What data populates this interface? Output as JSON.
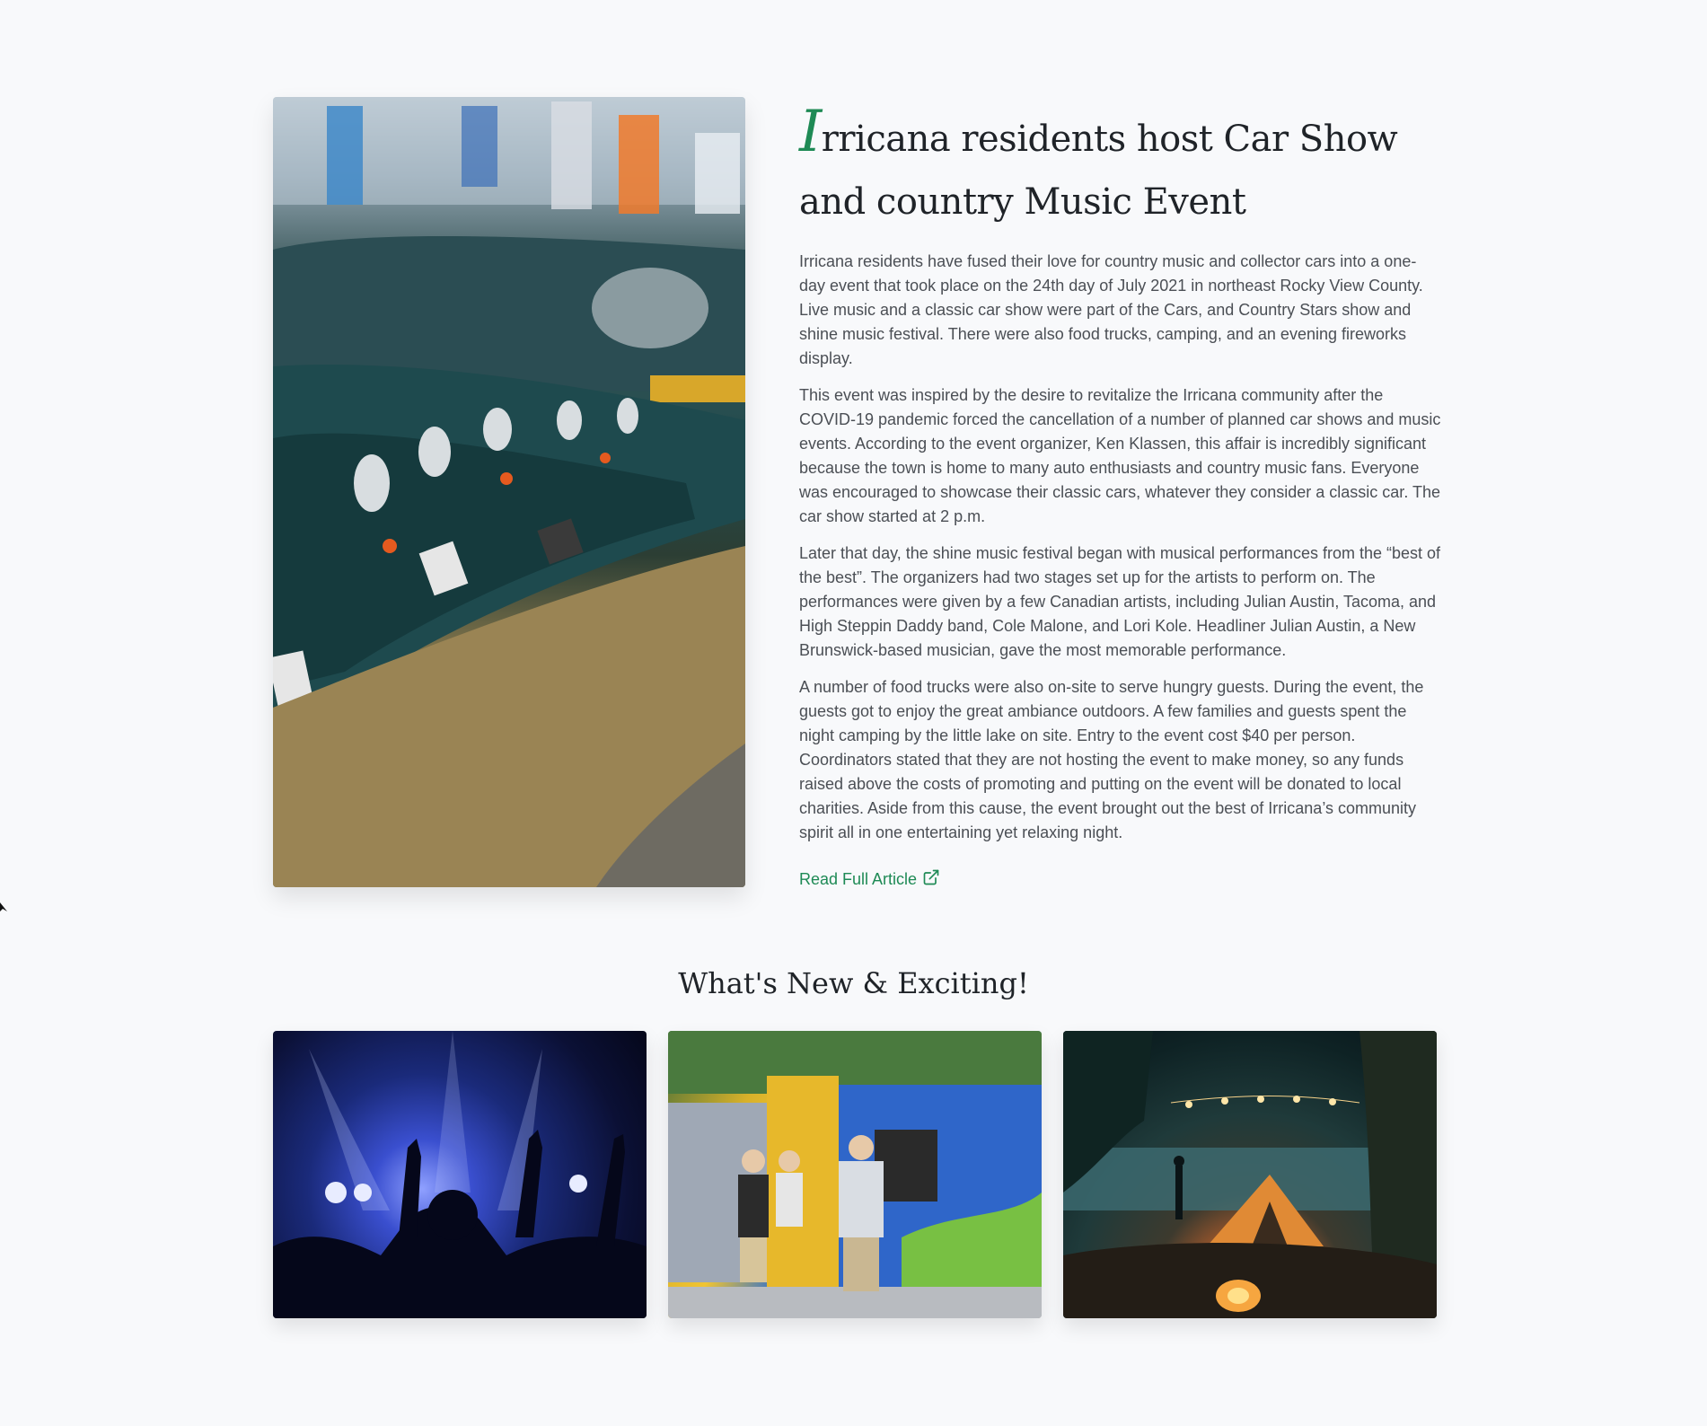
{
  "article": {
    "hero_image_icon": "classic-cars-row-photo",
    "headline_dropcap": "I",
    "headline_rest": "rricana residents host Car Show and country Music Event",
    "paragraphs": [
      "Irricana residents have fused their love for country music and collector cars into a one-day event that took place on the 24th day of July 2021 in northeast Rocky View County. Live music and a classic car show were part of the Cars, and Country Stars show and shine music festival. There were also food trucks, camping, and an evening fireworks display.",
      "This event was inspired by the desire to revitalize the Irricana community after the COVID-19 pandemic forced the cancellation of a number of planned car shows and music events. According to the event organizer, Ken Klassen, this affair is incredibly significant because the town is home to many auto enthusiasts and country music fans. Everyone was encouraged to showcase their classic cars, whatever they consider a classic car. The car show started at 2 p.m.",
      "Later that day, the shine music festival began with musical performances from the “best of the best”. The organizers had two stages set up for the artists to perform on. The performances were given by a few Canadian artists, including Julian Austin, Tacoma, and High Steppin Daddy band, Cole Malone, and Lori Kole. Headliner Julian Austin, a New Brunswick-based musician, gave the most memorable performance.",
      "A number of food trucks were also on-site to serve hungry guests. During the event, the guests got to enjoy the great ambiance outdoors. A few families and guests spent the night camping by the little lake on site. Entry to the event cost $40 per person. Coordinators stated that they are not hosting the event to make money, so any funds raised above the costs of promoting and putting on the event will be donated to local charities. Aside from this cause, the event brought out the best of Irricana’s community spirit all in one entertaining yet relaxing night."
    ],
    "read_more_label": "Read Full Article",
    "read_more_icon": "external-link-icon"
  },
  "section": {
    "title": "What's New & Exciting!"
  },
  "gallery": [
    {
      "icon": "concert-crowd-photo"
    },
    {
      "icon": "food-truck-photo"
    },
    {
      "icon": "lakeside-camping-photo"
    }
  ],
  "colors": {
    "accent": "#1e8a55",
    "background": "#f8f9fb",
    "heading": "#1f2328",
    "body_text": "#4b4f55"
  }
}
